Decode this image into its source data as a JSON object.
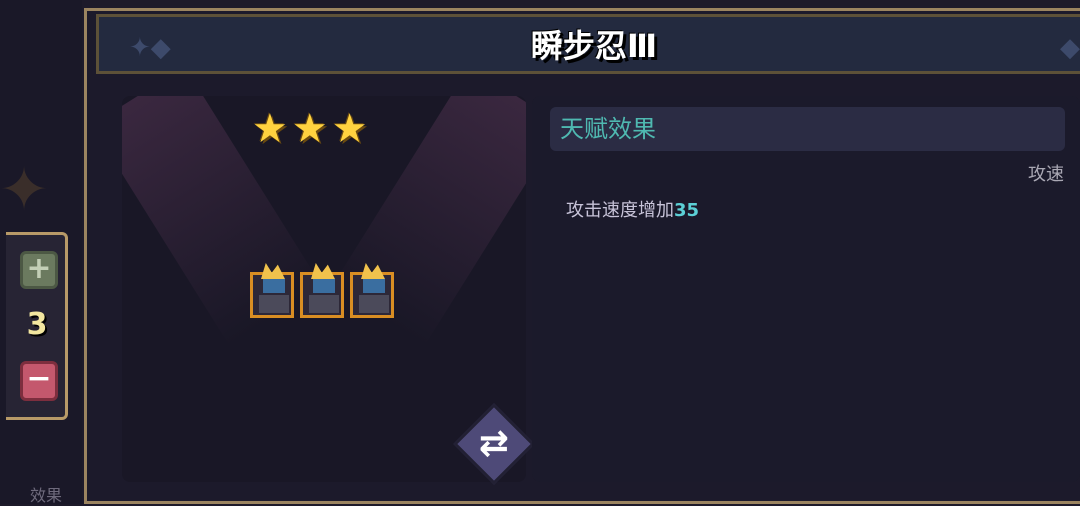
{
  "hero": {
    "name": "瞬步忍Ⅲ",
    "stars": 3,
    "unit_count": 3
  },
  "counter": {
    "plus_symbol": "+",
    "value": "3",
    "minus_symbol": "−"
  },
  "bottom_label": "效果",
  "talent": {
    "title": "天赋效果",
    "tag": "攻速",
    "description_prefix": "攻击速度增加",
    "description_value": "35"
  },
  "icons": {
    "star": "star-icon",
    "swap": "swap-icon",
    "plus": "plus-icon",
    "minus": "minus-icon"
  },
  "colors": {
    "star": "#ffd23f",
    "talent_title": "#4fb9b1",
    "talent_value": "#5cd0d6",
    "unit_border": "#d98e23"
  }
}
